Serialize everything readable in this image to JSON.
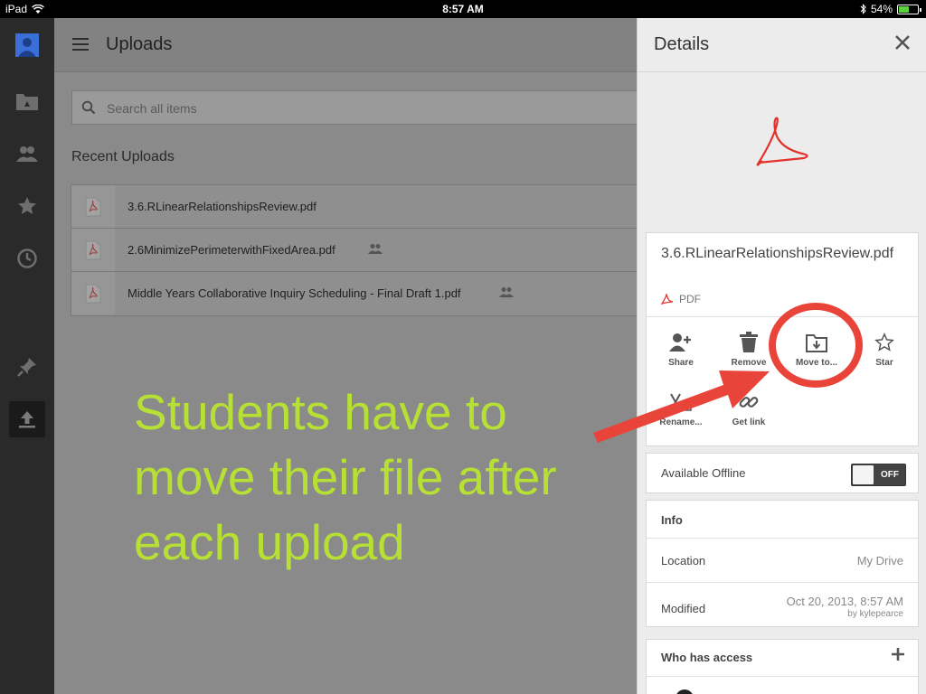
{
  "status_bar": {
    "device": "iPad",
    "time": "8:57 AM",
    "battery": "54%",
    "battery_level": 0.54
  },
  "main": {
    "title": "Uploads",
    "search_placeholder": "Search all items",
    "section_title": "Recent Uploads",
    "files": [
      {
        "name": "3.6.RLinearRelationshipsReview.pdf",
        "shared": false
      },
      {
        "name": "2.6MinimizePerimeterwithFixedArea.pdf",
        "shared": true
      },
      {
        "name": "Middle Years Collaborative Inquiry Scheduling - Final Draft 1.pdf",
        "shared": true
      }
    ]
  },
  "annotation": {
    "text": "Students have to move their file after each upload",
    "color": "#b7e034",
    "arrow_color": "#e8443a"
  },
  "details": {
    "title": "Details",
    "file_name": "3.6.RLinearRelationshipsReview.pdf",
    "file_type": "PDF",
    "actions": {
      "share": "Share",
      "remove": "Remove",
      "move": "Move to...",
      "star": "Star",
      "rename": "Rename...",
      "get_link": "Get link"
    },
    "offline": {
      "label": "Available Offline",
      "state": "OFF"
    },
    "info": {
      "header": "Info",
      "location_label": "Location",
      "location_value": "My Drive",
      "modified_label": "Modified",
      "modified_value": "Oct 20, 2013, 8:57 AM",
      "modified_by": "by kylepearce"
    },
    "access": {
      "header": "Who has access"
    }
  },
  "colors": {
    "pdf_red": "#e2322b",
    "accent_blue": "#3a6fd8"
  }
}
